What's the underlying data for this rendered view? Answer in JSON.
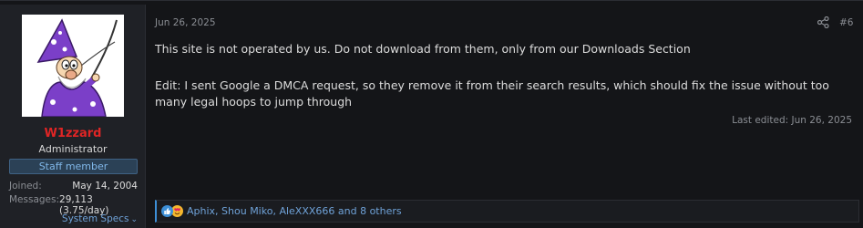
{
  "user": {
    "name": "W1zzard",
    "title": "Administrator",
    "banner": "Staff member",
    "stats": [
      {
        "label": "Joined:",
        "value": "May 14, 2004"
      },
      {
        "label": "Messages:",
        "value": "29,113 (3.75/day)"
      }
    ],
    "specs_link": "System Specs",
    "colors": {
      "username": "#e02525",
      "banner_bg": "#2b4156"
    }
  },
  "post": {
    "date": "Jun 26, 2025",
    "number": "#6",
    "paragraphs": [
      "This site is not operated by us. Do not download from them, only from our Downloads Section",
      "Edit: I sent Google a DMCA request, so they remove it from their search results, which should fix the issue without too many legal hoops to jump through"
    ],
    "last_edited": "Last edited: Jun 26, 2025"
  },
  "reactions": {
    "icons": [
      "like-icon",
      "love-icon"
    ],
    "text": "Aphix, Shou Miko, AleXXX666 and 8 others"
  },
  "icons": {
    "share": "share-icon",
    "specs_chevron": "chevron-down-icon"
  }
}
